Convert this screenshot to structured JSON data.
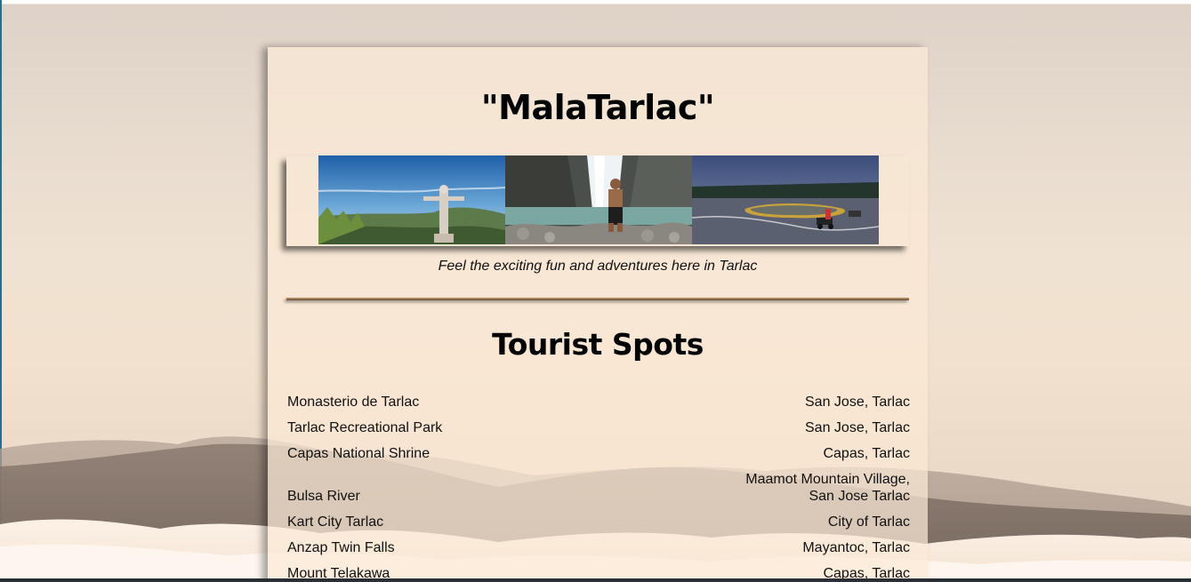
{
  "page": {
    "title": "\"MalaTarlac\"",
    "tagline": "Feel the exciting fun and adventures here in Tarlac"
  },
  "banner": {
    "photos": [
      {
        "icon": "statue-photo"
      },
      {
        "icon": "waterfall-photo"
      },
      {
        "icon": "kart-track-photo"
      }
    ]
  },
  "tourist_spots": {
    "heading": "Tourist Spots",
    "items": [
      {
        "name": "Monasterio de Tarlac",
        "location": "San Jose, Tarlac"
      },
      {
        "name": "Tarlac Recreational Park",
        "location": "San Jose, Tarlac"
      },
      {
        "name": "Capas National Shrine",
        "location": "Capas, Tarlac"
      },
      {
        "name": "Bulsa River",
        "location": "Maamot Mountain Village, San Jose Tarlac"
      },
      {
        "name": "Kart City Tarlac",
        "location": "City of Tarlac"
      },
      {
        "name": "Anzap Twin Falls",
        "location": "Mayantoc, Tarlac"
      },
      {
        "name": "Mount Telakawa",
        "location": "Capas, Tarlac"
      }
    ]
  },
  "colors": {
    "card": "#fbe9d6",
    "divider": "#8c6a48",
    "text": "#111111"
  }
}
